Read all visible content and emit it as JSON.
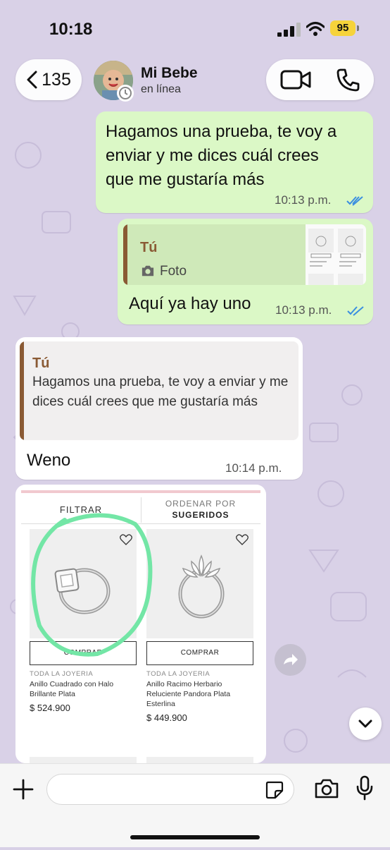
{
  "status_bar": {
    "time": "10:18",
    "battery": "95"
  },
  "header": {
    "back_count": "135",
    "contact_name": "Mi Bebe",
    "contact_status": "en línea"
  },
  "messages": [
    {
      "direction": "out",
      "text_lines": [
        "Hagamos una prueba, te voy a",
        "enviar y me dices cuál crees",
        "que me gustaría más"
      ],
      "time": "10:13 p.m."
    },
    {
      "direction": "out",
      "quote_author": "Tú",
      "quote_label": "Foto",
      "text": "Aquí ya hay uno",
      "time": "10:13 p.m."
    },
    {
      "direction": "in",
      "quote_author": "Tú",
      "quote_text": "Hagamos una prueba, te voy a enviar y me dices cuál crees que me gustaría más",
      "text": "Weno",
      "time": "10:14 p.m."
    }
  ],
  "shop": {
    "filter_label": "FILTRAR",
    "order_label": "ORDENAR POR",
    "order_value": "SUGERIDOS",
    "products": [
      {
        "button": "COMPRAR",
        "category": "TODA LA JOYERIA",
        "name": "Anillo Cuadrado con Halo Brillante Plata",
        "price": "$ 524.900"
      },
      {
        "button": "COMPRAR",
        "category": "TODA LA JOYERIA",
        "name": "Anillo Racimo Herbario Reluciente Pandora Plata Esterlina",
        "price": "$ 449.900"
      }
    ]
  },
  "input": {
    "placeholder": ""
  },
  "colors": {
    "outgoing_bubble": "#dbf8c6",
    "incoming_bubble": "#ffffff",
    "quote_accent": "#8a5a34",
    "read_ticks": "#3b8fe0",
    "highlight_circle": "#73e6a6"
  }
}
